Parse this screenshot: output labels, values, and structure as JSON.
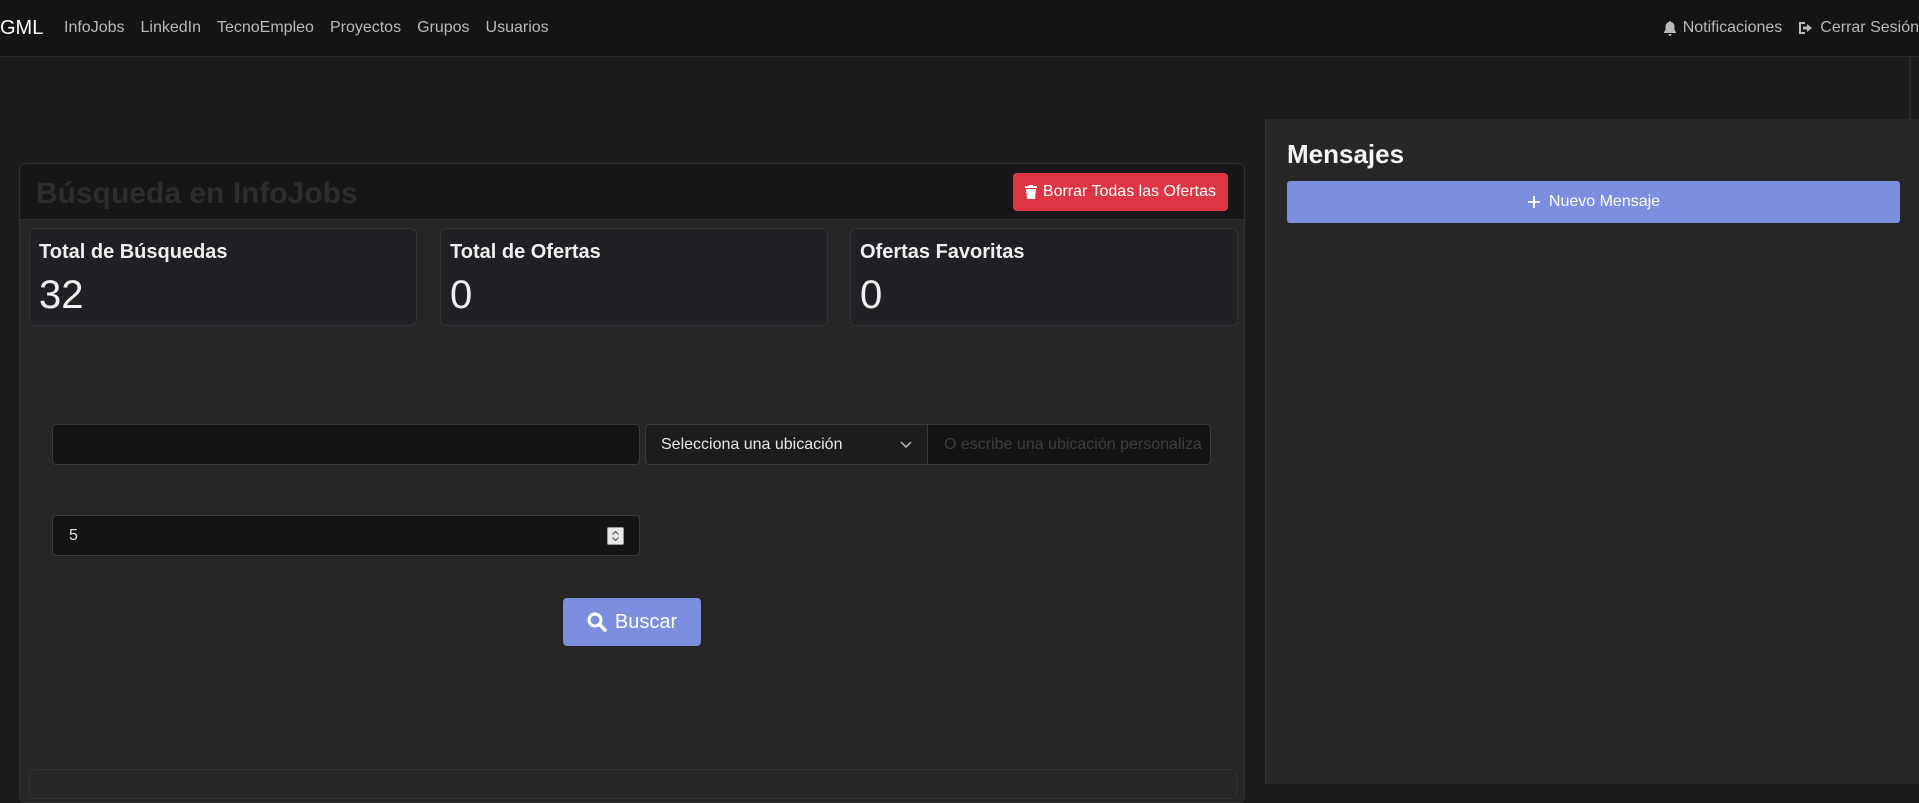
{
  "navbar": {
    "brand": "GML",
    "links": [
      "InfoJobs",
      "LinkedIn",
      "TecnoEmpleo",
      "Proyectos",
      "Grupos",
      "Usuarios"
    ],
    "notifications_label": "Notificaciones",
    "logout_label": "Cerrar Sesión"
  },
  "search_card": {
    "title": "Búsqueda en InfoJobs",
    "delete_all_label": "Borrar Todas las Ofertas",
    "stats": [
      {
        "label": "Total de Búsquedas",
        "value": "32"
      },
      {
        "label": "Total de Ofertas",
        "value": "0"
      },
      {
        "label": "Ofertas Favoritas",
        "value": "0"
      }
    ],
    "keywords_value": "",
    "location_select_value": "Selecciona una ubicación",
    "custom_location_placeholder": "O escribe una ubicación personaliza",
    "quantity_value": "5",
    "search_label": "Buscar"
  },
  "messages_panel": {
    "title": "Mensajes",
    "new_message_label": "Nuevo Mensaje"
  },
  "colors": {
    "primary": "#7b8fde",
    "danger": "#dc3545",
    "background": "#1b1b1b"
  }
}
